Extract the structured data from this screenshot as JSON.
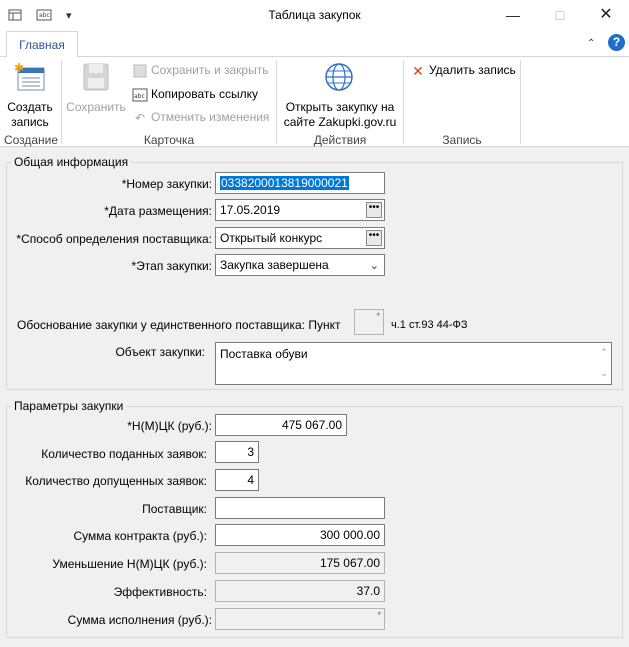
{
  "window": {
    "title": "Таблица закупок",
    "minimize_icon": "minimize-icon",
    "maximize_icon": "maximize-icon",
    "close_icon": "close-icon"
  },
  "ribbon": {
    "active_tab": "Главная",
    "groups": {
      "create": {
        "label": "Создание",
        "create_button": "Создать запись"
      },
      "card": {
        "label": "Карточка",
        "save_button": "Сохранить",
        "save_close_button": "Сохранить и закрыть",
        "copy_link_button": "Копировать ссылку",
        "cancel_changes_button": "Отменить изменения"
      },
      "actions": {
        "label": "Действия",
        "open_site_button": "Открыть закупку на сайте Zakupki.gov.ru"
      },
      "record": {
        "label": "Запись",
        "delete_button": "Удалить запись"
      }
    },
    "help_icon": "help-icon"
  },
  "general": {
    "title": "Общая информация",
    "purchase_number_label": "*Номер закупки:",
    "purchase_number": "0338200013819000021",
    "publish_date_label": "*Дата размещения:",
    "publish_date": "17.05.2019",
    "supplier_method_label": "*Способ определения поставщика:",
    "supplier_method": "Открытый конкурс",
    "stage_label": "*Этап закупки:",
    "stage": "Закупка завершена",
    "single_supplier_label": "Обоснование закупки у единственного поставщика: Пункт",
    "single_supplier_suffix": "ч.1 ст.93 44-ФЗ",
    "object_label": "Объект закупки:",
    "object_value": "Поставка обуви"
  },
  "params": {
    "title": "Параметры закупки",
    "nmck_label": "*Н(М)ЦК (руб.):",
    "nmck": "475 067.00",
    "submitted_label": "Количество поданных заявок:",
    "submitted": "3",
    "admitted_label": "Количество допущенных заявок:",
    "admitted": "4",
    "supplier_label": "Поставщик:",
    "supplier": "",
    "contract_sum_label": "Сумма контракта (руб.):",
    "contract_sum": "300 000.00",
    "reduction_label": "Уменьшение Н(М)ЦК (руб.):",
    "reduction": "175 067.00",
    "efficiency_label": "Эффективность:",
    "efficiency": "37.0",
    "execution_sum_label": "Сумма исполнения (руб.):",
    "execution_sum": ""
  }
}
